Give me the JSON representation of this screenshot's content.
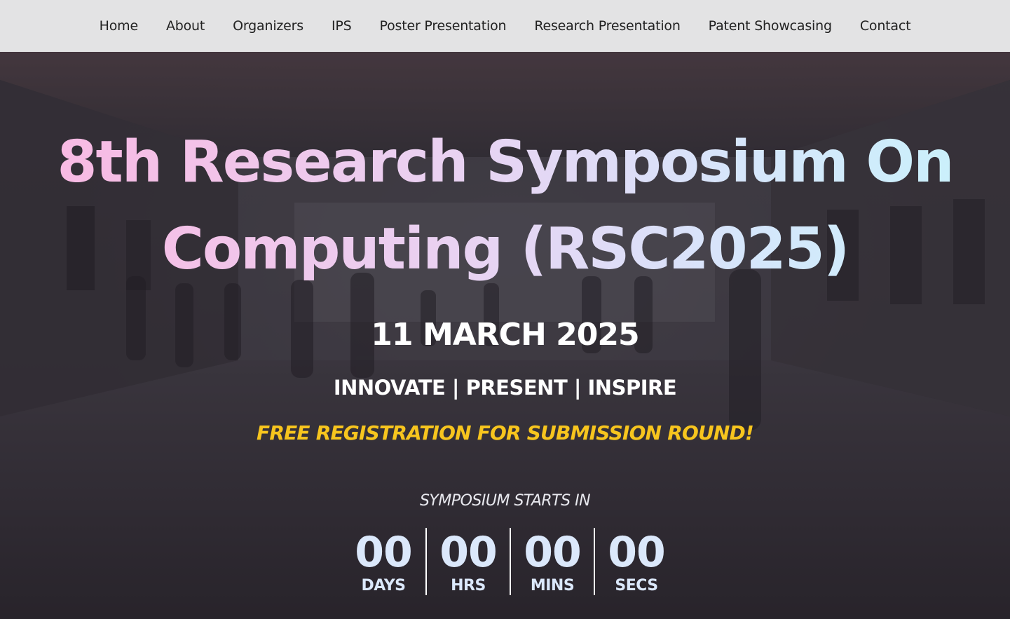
{
  "nav": {
    "items": [
      {
        "label": "Home"
      },
      {
        "label": "About"
      },
      {
        "label": "Organizers"
      },
      {
        "label": "IPS"
      },
      {
        "label": "Poster Presentation"
      },
      {
        "label": "Research Presentation"
      },
      {
        "label": "Patent Showcasing"
      },
      {
        "label": "Contact"
      }
    ]
  },
  "hero": {
    "title_line1": "8th Research Symposium On",
    "title_line2": "Computing (RSC2025)",
    "date": "11 MARCH 2025",
    "tagline": "INNOVATE | PRESENT | INSPIRE",
    "promo": "FREE REGISTRATION FOR SUBMISSION ROUND!",
    "countdown_heading": "SYMPOSIUM STARTS IN",
    "countdown": [
      {
        "value": "00",
        "label": "DAYS"
      },
      {
        "value": "00",
        "label": "HRS"
      },
      {
        "value": "00",
        "label": "MINS"
      },
      {
        "value": "00",
        "label": "SECS"
      }
    ]
  },
  "colors": {
    "navbar_bg": "#e3e3e4",
    "promo": "#f7c51e",
    "countdown": "#dbe8fb",
    "title_gradient_start": "#f9b8e2",
    "title_gradient_end": "#c9f1fb"
  }
}
